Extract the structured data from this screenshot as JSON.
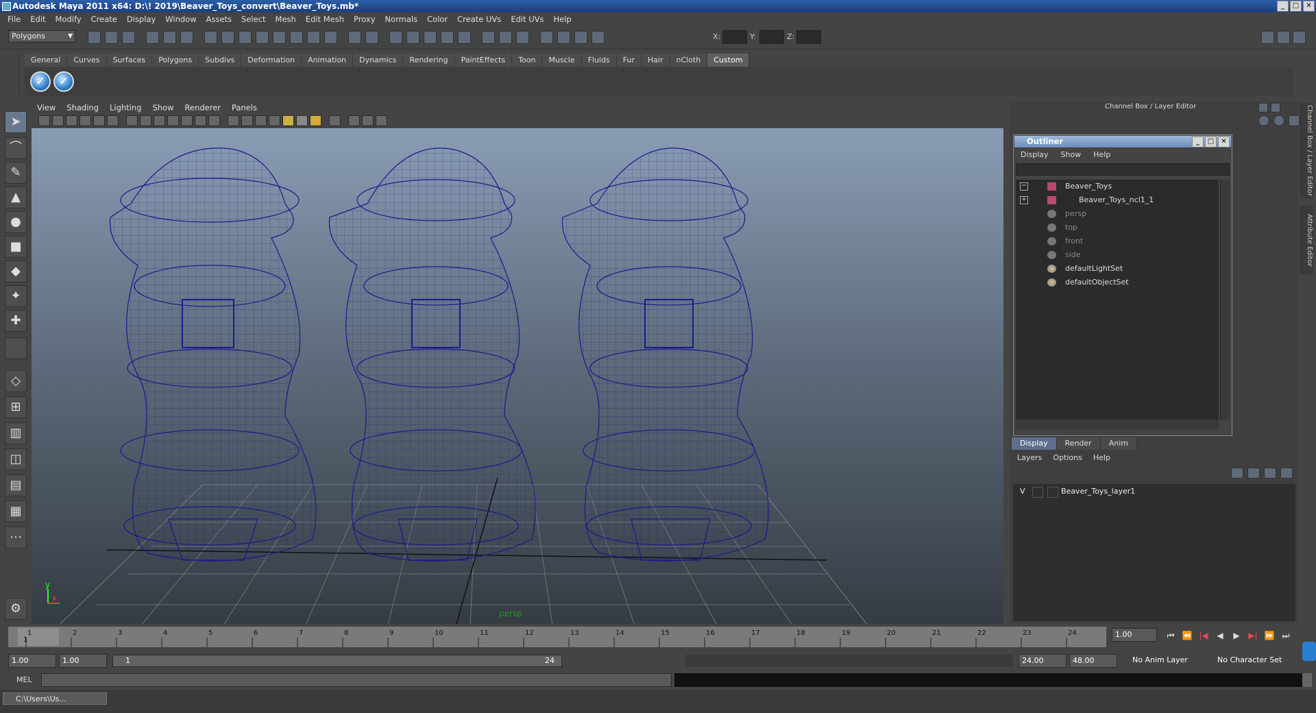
{
  "title": "Autodesk Maya 2011 x64: D:\\! 2019\\Beaver_Toys_convert\\Beaver_Toys.mb*",
  "window_controls": [
    "_",
    "□",
    "✕"
  ],
  "menubar": [
    "File",
    "Edit",
    "Modify",
    "Create",
    "Display",
    "Window",
    "Assets",
    "Select",
    "Mesh",
    "Edit Mesh",
    "Proxy",
    "Normals",
    "Color",
    "Create UVs",
    "Edit UVs",
    "Help"
  ],
  "mode_selector": "Polygons",
  "xyz_labels": [
    "X:",
    "Y:",
    "Z:"
  ],
  "shelf_tabs": [
    "General",
    "Curves",
    "Surfaces",
    "Polygons",
    "Subdivs",
    "Deformation",
    "Animation",
    "Dynamics",
    "Rendering",
    "PaintEffects",
    "Toon",
    "Muscle",
    "Fluids",
    "Fur",
    "Hair",
    "nCloth",
    "Custom"
  ],
  "active_shelf": "Custom",
  "panel_menu": [
    "View",
    "Shading",
    "Lighting",
    "Show",
    "Renderer",
    "Panels"
  ],
  "viewport_camera_label": "persp",
  "axis_labels": {
    "y": "y",
    "x": "x"
  },
  "right_panel_title": "Channel Box / Layer Editor",
  "side_tabs": [
    "Channel Box / Layer Editor",
    "Attribute Editor"
  ],
  "outliner": {
    "title": "Outliner",
    "menu": [
      "Display",
      "Show",
      "Help"
    ],
    "items": [
      {
        "label": "Beaver_Toys",
        "icon": "transform-icon",
        "dim": false
      },
      {
        "label": "Beaver_Toys_ncl1_1",
        "icon": "transform-icon",
        "dim": false
      },
      {
        "label": "persp",
        "icon": "camera-icon",
        "dim": true
      },
      {
        "label": "top",
        "icon": "camera-icon",
        "dim": true
      },
      {
        "label": "front",
        "icon": "camera-icon",
        "dim": true
      },
      {
        "label": "side",
        "icon": "camera-icon",
        "dim": true
      },
      {
        "label": "defaultLightSet",
        "icon": "set-icon",
        "dim": false
      },
      {
        "label": "defaultObjectSet",
        "icon": "set-icon",
        "dim": false
      }
    ]
  },
  "layer_editor": {
    "tabs": [
      "Display",
      "Render",
      "Anim"
    ],
    "menu": [
      "Layers",
      "Options",
      "Help"
    ],
    "layers": [
      {
        "visible": "V",
        "name": "Beaver_Toys_layer1"
      }
    ]
  },
  "timeline": {
    "ticks": [
      "1",
      "2",
      "3",
      "4",
      "5",
      "6",
      "7",
      "8",
      "9",
      "10",
      "11",
      "12",
      "13",
      "14",
      "15",
      "16",
      "17",
      "18",
      "19",
      "20",
      "21",
      "22",
      "23",
      "24"
    ],
    "current_frame": "1.00",
    "frame_marker": "1"
  },
  "range": {
    "start": "1.00",
    "playback_start": "1.00",
    "slider_start": "1",
    "slider_end": "24",
    "playback_end": "24.00",
    "end": "48.00",
    "anim_layer": "No Anim Layer",
    "character_set": "No Character Set"
  },
  "cmd_label": "MEL",
  "taskbar_item": "C:\\Users\\Us...",
  "colors": {
    "wireframe": "#1a1a8c",
    "accent": "#5d6f8c",
    "title_bar": "#2c5ea8"
  }
}
